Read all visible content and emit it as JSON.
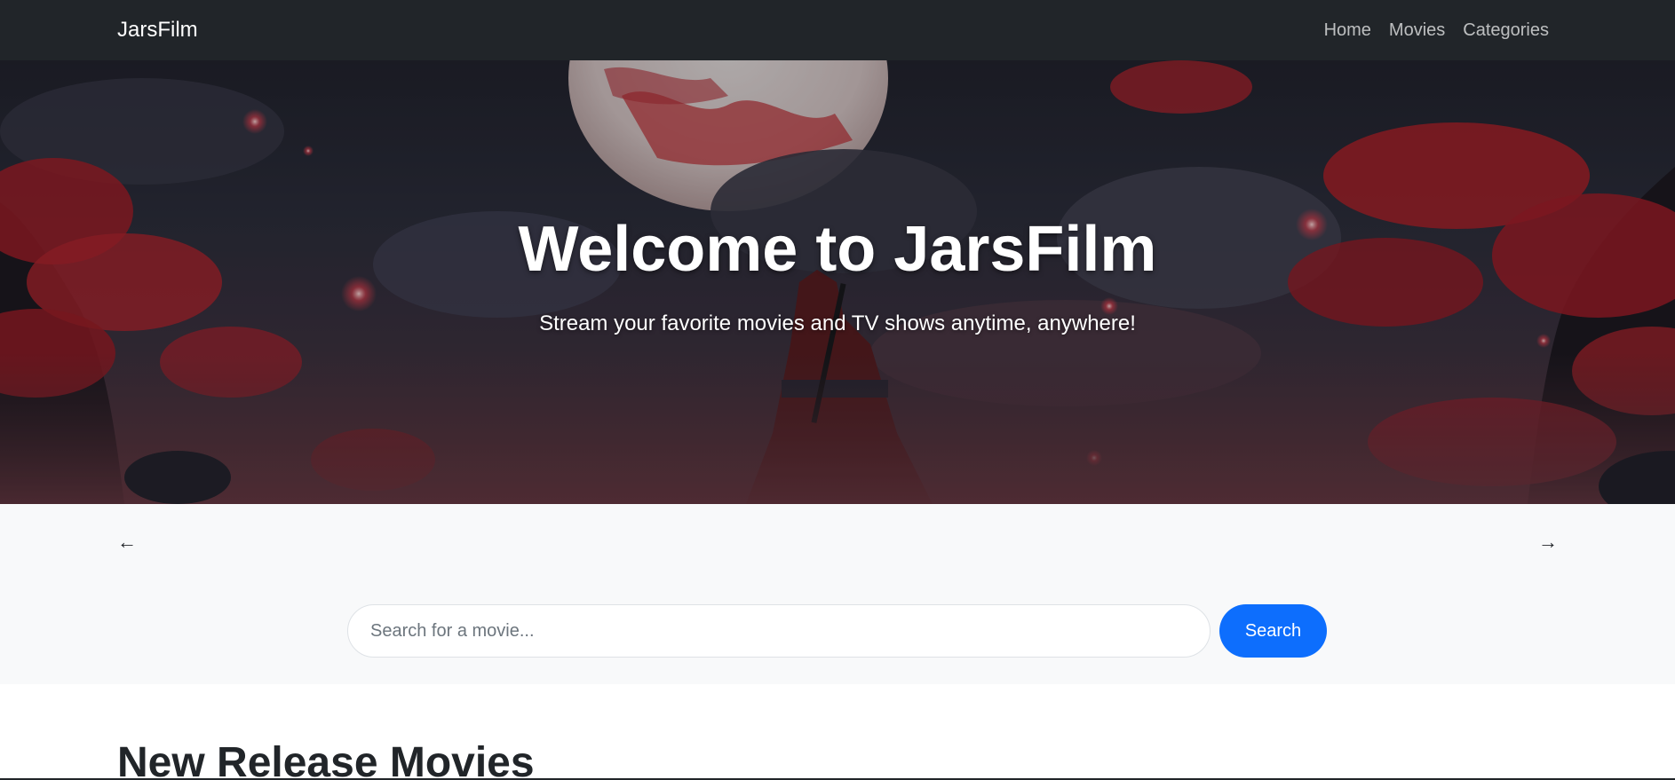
{
  "navbar": {
    "brand": "JarsFilm",
    "links": [
      "Home",
      "Movies",
      "Categories"
    ]
  },
  "hero": {
    "title": "Welcome to JarsFilm",
    "subtitle": "Stream your favorite movies and TV shows anytime, anywhere!"
  },
  "carousel": {
    "prev_label": "←",
    "next_label": "→"
  },
  "search": {
    "placeholder": "Search for a movie...",
    "value": "",
    "button_label": "Search"
  },
  "sections": {
    "new_release_title": "New Release Movies"
  },
  "colors": {
    "navbar_bg": "#212529",
    "primary": "#0d6efd",
    "band_bg": "#f8f9fa",
    "accent_red": "#c0202a"
  }
}
